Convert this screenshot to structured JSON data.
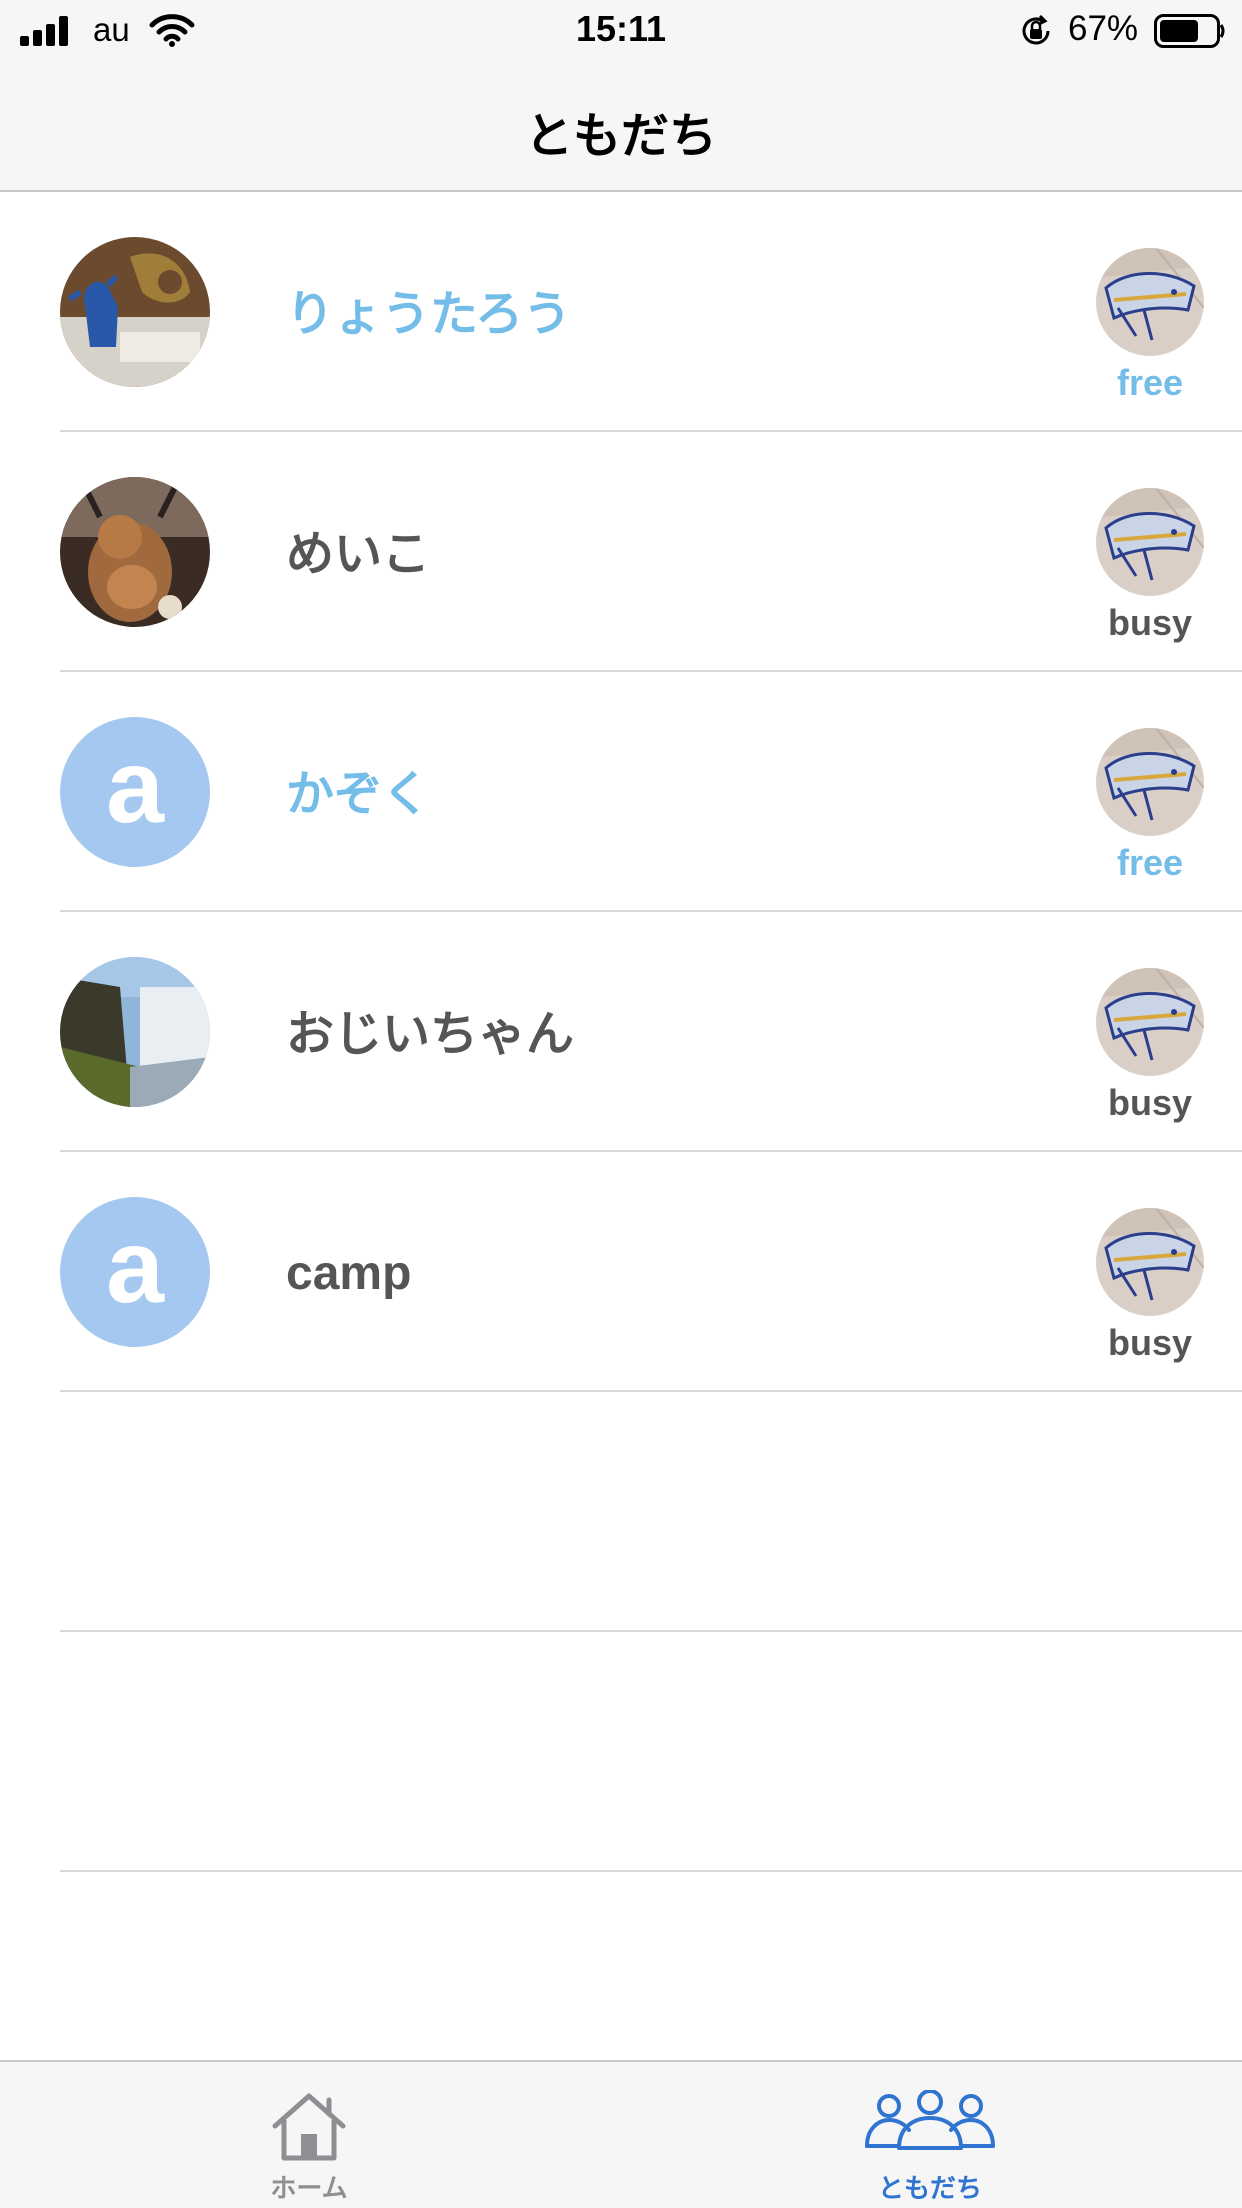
{
  "status_bar": {
    "carrier": "au",
    "time": "15:11",
    "battery_percent": "67%"
  },
  "nav": {
    "title": "ともだち"
  },
  "friends": [
    {
      "name": "りょうたろう",
      "status": "free",
      "avatar": "photo-godzilla-figure",
      "name_color": "#74bde9"
    },
    {
      "name": "めいこ",
      "status": "busy",
      "avatar": "photo-lion-plush",
      "name_color": "#555555"
    },
    {
      "name": "かぞく",
      "status": "free",
      "avatar_letter": "a",
      "name_color": "#74bde9"
    },
    {
      "name": "おじいちゃん",
      "status": "busy",
      "avatar": "photo-waterfall",
      "name_color": "#555555"
    },
    {
      "name": "camp",
      "status": "busy",
      "avatar_letter": "a",
      "name_color": "#555555"
    }
  ],
  "tab_bar": {
    "home_label": "ホーム",
    "friends_label": "ともだち",
    "active_color": "#2f74d0",
    "inactive_color": "#8e8e93"
  }
}
